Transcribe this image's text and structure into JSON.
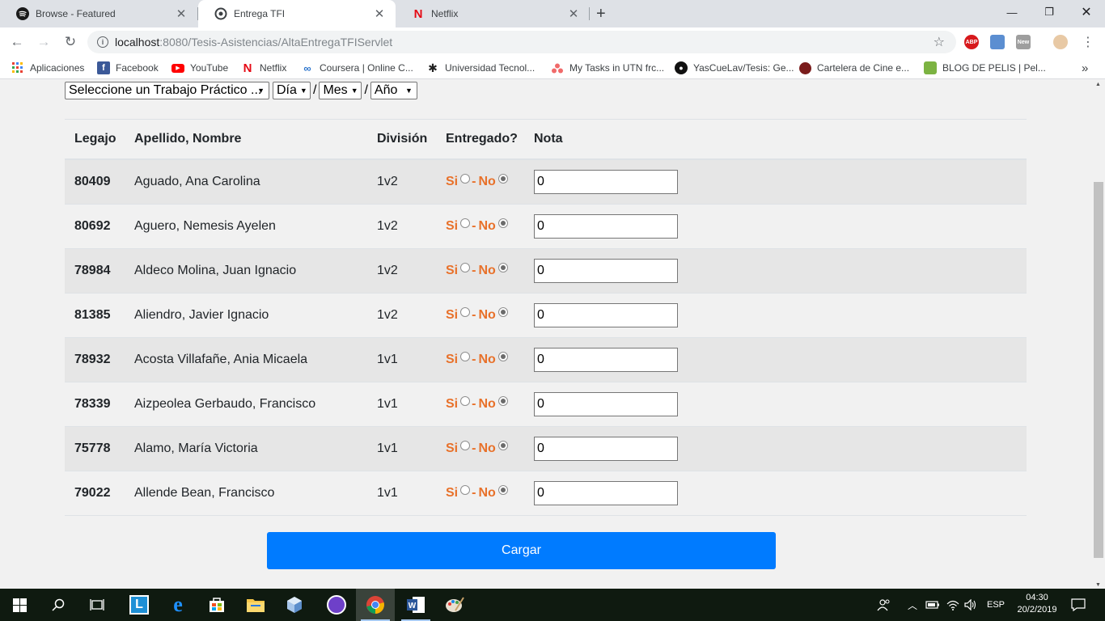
{
  "browser": {
    "tabs": [
      {
        "title": "Browse - Featured",
        "icon": "spotify-icon"
      },
      {
        "title": "Entrega TFI",
        "icon": "chrome-page-icon"
      },
      {
        "title": "Netflix",
        "icon": "netflix-icon"
      }
    ],
    "url_host": "localhost",
    "url_path": ":8080/Tesis-Asistencias/AltaEntregaTFIServlet",
    "bookmarks": [
      {
        "label": "Aplicaciones",
        "icon": "apps-grid-icon"
      },
      {
        "label": "Facebook",
        "icon": "facebook-icon"
      },
      {
        "label": "YouTube",
        "icon": "youtube-icon"
      },
      {
        "label": "Netflix",
        "icon": "netflix-icon"
      },
      {
        "label": "Coursera | Online C...",
        "icon": "coursera-icon"
      },
      {
        "label": "Universidad Tecnol...",
        "icon": "utn-icon"
      },
      {
        "label": "My Tasks in UTN frc...",
        "icon": "asana-icon"
      },
      {
        "label": "YasCueLav/Tesis: Ge...",
        "icon": "github-icon"
      },
      {
        "label": "Cartelera de Cine e...",
        "icon": "cinema-icon"
      },
      {
        "label": "BLOG DE PELIS | Pel...",
        "icon": "blog-icon"
      }
    ],
    "more_bookmarks": "»",
    "ext_abp": "ABP",
    "ext_new": "New"
  },
  "filters": {
    "tp_select": "Seleccione un Trabajo Práctico ...",
    "day_select": "Día",
    "month_select": "Mes",
    "year_select": "Año",
    "separator": "/"
  },
  "table": {
    "headers": {
      "legajo": "Legajo",
      "nombre": "Apellido, Nombre",
      "division": "División",
      "entregado": "Entregado?",
      "nota": "Nota"
    },
    "si_label": "Si",
    "no_label": "No",
    "dash": "-",
    "rows": [
      {
        "legajo": "80409",
        "nombre": "Aguado, Ana Carolina",
        "division": "1v2",
        "entregado": "No",
        "nota": "0"
      },
      {
        "legajo": "80692",
        "nombre": "Aguero, Nemesis Ayelen",
        "division": "1v2",
        "entregado": "No",
        "nota": "0"
      },
      {
        "legajo": "78984",
        "nombre": "Aldeco Molina, Juan Ignacio",
        "division": "1v2",
        "entregado": "No",
        "nota": "0"
      },
      {
        "legajo": "81385",
        "nombre": "Aliendro, Javier Ignacio",
        "division": "1v2",
        "entregado": "No",
        "nota": "0"
      },
      {
        "legajo": "78932",
        "nombre": "Acosta Villafañe, Ania Micaela",
        "division": "1v1",
        "entregado": "No",
        "nota": "0"
      },
      {
        "legajo": "78339",
        "nombre": "Aizpeolea Gerbaudo, Francisco",
        "division": "1v1",
        "entregado": "No",
        "nota": "0"
      },
      {
        "legajo": "75778",
        "nombre": "Alamo, María Victoria",
        "division": "1v1",
        "entregado": "No",
        "nota": "0"
      },
      {
        "legajo": "79022",
        "nombre": "Allende Bean, Francisco",
        "division": "1v1",
        "entregado": "No",
        "nota": "0"
      }
    ]
  },
  "submit_label": "Cargar",
  "taskbar": {
    "language": "ESP",
    "time": "04:30",
    "date": "20/2/2019"
  },
  "colors": {
    "primary_button": "#007bff",
    "si_no_label": "#e8712a",
    "taskbar": "#0f1a10"
  }
}
